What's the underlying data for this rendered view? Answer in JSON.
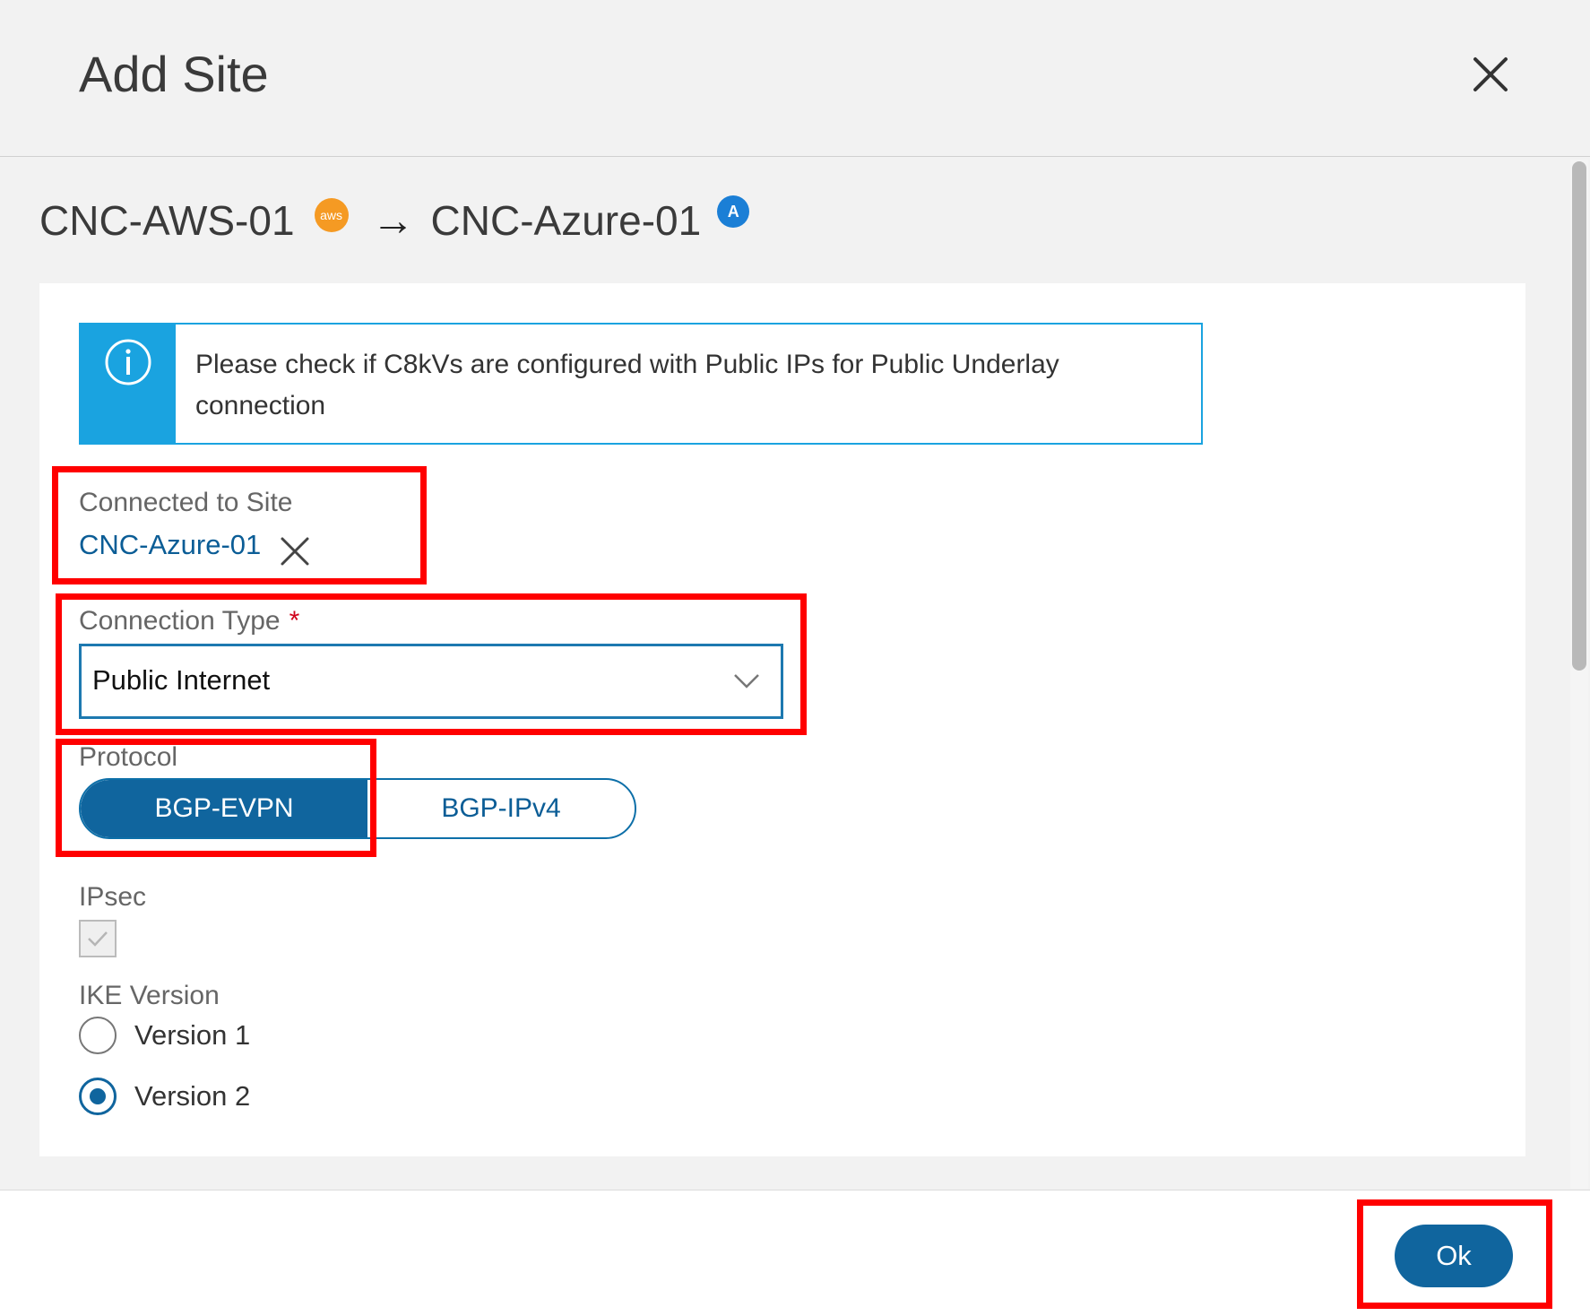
{
  "dialog": {
    "title": "Add Site"
  },
  "route": {
    "source": "CNC-AWS-01",
    "source_badge": "aws",
    "arrow": "→",
    "destination": "CNC-Azure-01",
    "destination_badge": "A"
  },
  "banner": {
    "icon": "info-icon",
    "text": "Please check if C8kVs are configured with Public IPs for Public Underlay connection"
  },
  "connected_site": {
    "label": "Connected to Site",
    "value": "CNC-Azure-01"
  },
  "connection_type": {
    "label": "Connection Type",
    "required_mark": "*",
    "selected": "Public Internet"
  },
  "protocol": {
    "label": "Protocol",
    "options": [
      "BGP-EVPN",
      "BGP-IPv4"
    ],
    "selected": "BGP-EVPN"
  },
  "ipsec": {
    "label": "IPsec",
    "checked": true,
    "disabled": true
  },
  "ike": {
    "label": "IKE Version",
    "options": [
      "Version 1",
      "Version 2"
    ],
    "selected": "Version 2"
  },
  "footer": {
    "ok_label": "Ok"
  },
  "colors": {
    "accent": "#10659e",
    "info": "#1aa3e0",
    "highlight": "#ff0000",
    "aws": "#f59a23",
    "azure": "#1b7fd6"
  }
}
